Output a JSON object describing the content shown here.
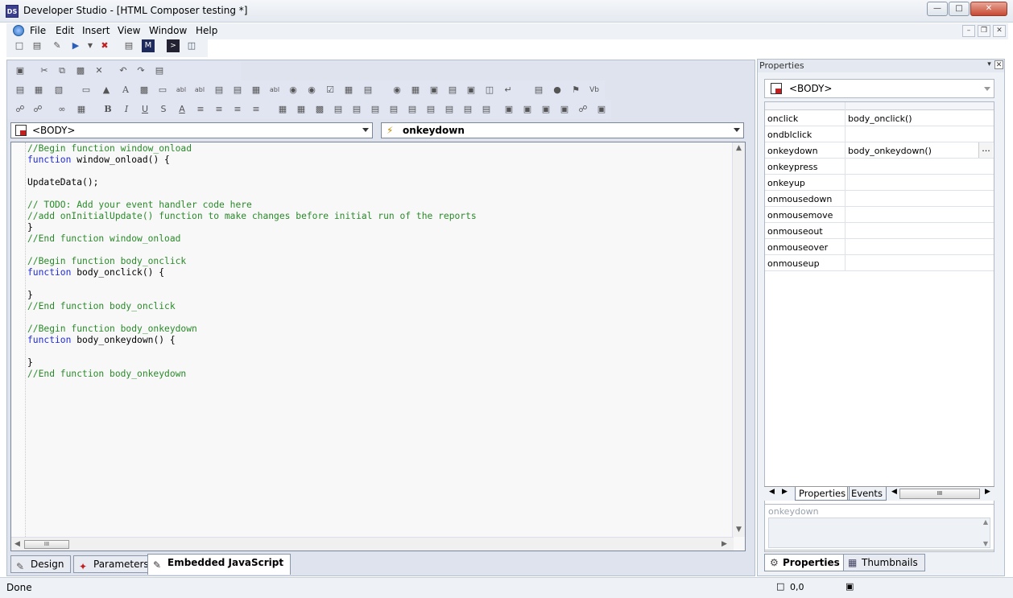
{
  "window": {
    "title": "Developer Studio - [HTML Composer testing *]",
    "app_icon_text": "DS"
  },
  "menu": {
    "items": [
      "File",
      "Edit",
      "Insert",
      "View",
      "Window",
      "Help"
    ]
  },
  "editor": {
    "element_select": "<BODY>",
    "event_select": "onkeydown",
    "lines": [
      [
        {
          "t": "cmt",
          "v": "//Begin function window_onload"
        }
      ],
      [
        {
          "t": "kw",
          "v": "function"
        },
        {
          "t": "txt",
          "v": " window_onload() {"
        }
      ],
      [
        {
          "t": "txt",
          "v": ""
        }
      ],
      [
        {
          "t": "txt",
          "v": "UpdateData();"
        }
      ],
      [
        {
          "t": "txt",
          "v": ""
        }
      ],
      [
        {
          "t": "cmt",
          "v": "// TODO: Add your event handler code here"
        }
      ],
      [
        {
          "t": "cmt",
          "v": "//add onInitialUpdate() function to make changes before initial run of the reports"
        }
      ],
      [
        {
          "t": "txt",
          "v": "}"
        }
      ],
      [
        {
          "t": "cmt",
          "v": "//End function window_onload"
        }
      ],
      [
        {
          "t": "txt",
          "v": ""
        }
      ],
      [
        {
          "t": "cmt",
          "v": "//Begin function body_onclick"
        }
      ],
      [
        {
          "t": "kw",
          "v": "function"
        },
        {
          "t": "txt",
          "v": " body_onclick() {"
        }
      ],
      [
        {
          "t": "txt",
          "v": ""
        }
      ],
      [
        {
          "t": "txt",
          "v": "}"
        }
      ],
      [
        {
          "t": "cmt",
          "v": "//End function body_onclick"
        }
      ],
      [
        {
          "t": "txt",
          "v": ""
        }
      ],
      [
        {
          "t": "cmt",
          "v": "//Begin function body_onkeydown"
        }
      ],
      [
        {
          "t": "kw",
          "v": "function"
        },
        {
          "t": "txt",
          "v": " body_onkeydown() {"
        }
      ],
      [
        {
          "t": "txt",
          "v": ""
        }
      ],
      [
        {
          "t": "txt",
          "v": "}"
        }
      ],
      [
        {
          "t": "cmt",
          "v": "//End function body_onkeydown"
        }
      ]
    ],
    "hscroll_thumb": "III"
  },
  "bottom_tabs": [
    {
      "label": "Design",
      "active": false
    },
    {
      "label": "Parameters",
      "active": false
    },
    {
      "label": "Embedded JavaScript",
      "active": true
    }
  ],
  "status": {
    "text": "Done",
    "coords": "0,0"
  },
  "properties": {
    "title": "Properties",
    "object": "<BODY>",
    "events": [
      {
        "name": "onclick",
        "value": "body_onclick()"
      },
      {
        "name": "ondblclick",
        "value": ""
      },
      {
        "name": "onkeydown",
        "value": "body_onkeydown()",
        "selected": true
      },
      {
        "name": "onkeypress",
        "value": ""
      },
      {
        "name": "onkeyup",
        "value": ""
      },
      {
        "name": "onmousedown",
        "value": ""
      },
      {
        "name": "onmousemove",
        "value": ""
      },
      {
        "name": "onmouseout",
        "value": ""
      },
      {
        "name": "onmouseover",
        "value": ""
      },
      {
        "name": "onmouseup",
        "value": ""
      }
    ],
    "sheet_tabs": [
      "Properties",
      "Events"
    ],
    "ellipsis": "...",
    "hscroll_thumb": "III",
    "description_label": "onkeydown",
    "panel_tabs": [
      "Properties",
      "Thumbnails"
    ]
  }
}
